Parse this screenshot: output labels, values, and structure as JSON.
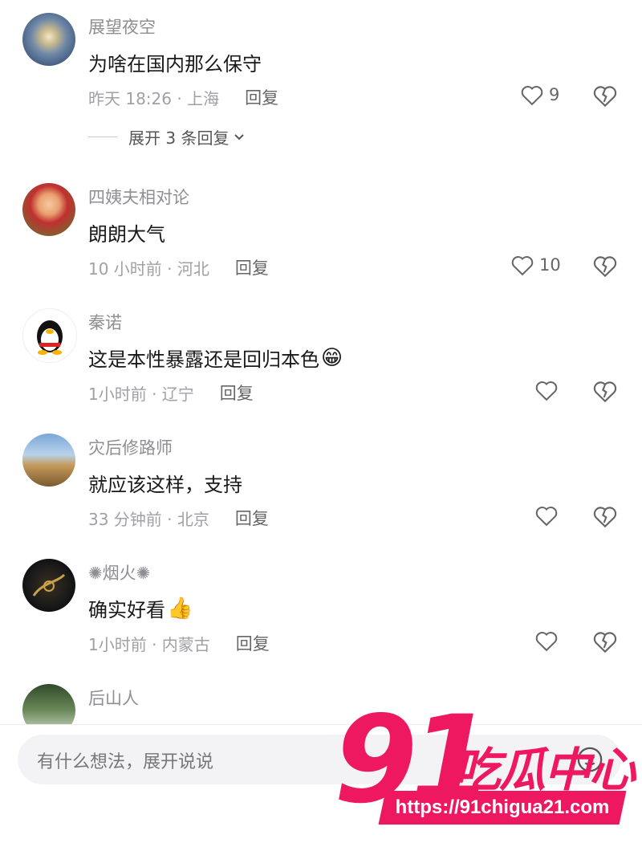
{
  "comments": [
    {
      "username": "展望夜空",
      "text": "为啥在国内那么保守",
      "time": "昨天 18:26 · 上海",
      "reply": "回复",
      "likes": "9",
      "expand": "展开 3 条回复"
    },
    {
      "username": "四姨夫相对论",
      "text": "朗朗大气",
      "time": "10 小时前 · 河北",
      "reply": "回复",
      "likes": "10"
    },
    {
      "username": "秦诺",
      "text": "这是本性暴露还是回归本色",
      "emoji": "😁",
      "time": "1小时前 · 辽宁",
      "reply": "回复",
      "likes": ""
    },
    {
      "username": "灾后修路师",
      "text": "就应该这样，支持",
      "time": "33 分钟前 · 北京",
      "reply": "回复",
      "likes": ""
    },
    {
      "username": "✺烟火✺",
      "text": "确实好看",
      "emoji": "👍",
      "time": "1小时前 · 内蒙古",
      "reply": "回复",
      "likes": ""
    },
    {
      "username": "后山人"
    }
  ],
  "input": {
    "placeholder": "有什么想法，展开说说"
  },
  "watermark": {
    "number": "91",
    "name": "吃瓜中心",
    "url": "https://91chigua21.com"
  },
  "colors": {
    "brand": "#ee1860",
    "text": "#1a1a1a",
    "muted": "#8e8e93"
  }
}
